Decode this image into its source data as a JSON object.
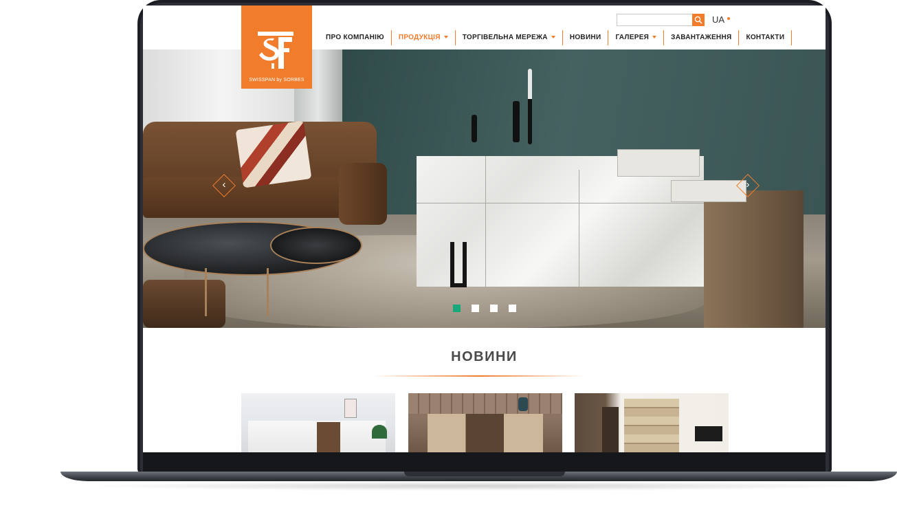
{
  "brand": {
    "logo_text": "SWISSPAN by SORBES",
    "accent_color": "#f07c2c",
    "active_dot_color": "#19a87a"
  },
  "header": {
    "search": {
      "placeholder": "",
      "icon": "search-icon"
    },
    "language": "UA"
  },
  "nav": {
    "items": [
      {
        "label": "ПРО КОМПАНІЮ",
        "active": false,
        "dropdown": false
      },
      {
        "label": "ПРОДУКЦІЯ",
        "active": true,
        "dropdown": true
      },
      {
        "label": "ТОРГІВЕЛЬНА МЕРЕЖА",
        "active": false,
        "dropdown": true
      },
      {
        "label": "НОВИНИ",
        "active": false,
        "dropdown": false
      },
      {
        "label": "ГАЛЕРЕЯ",
        "active": false,
        "dropdown": true
      },
      {
        "label": "ЗАВАНТАЖЕННЯ",
        "active": false,
        "dropdown": false
      },
      {
        "label": "КОНТАКТИ",
        "active": false,
        "dropdown": false
      }
    ]
  },
  "hero": {
    "prev_arrow": "‹",
    "next_arrow": "›",
    "slide_count": 4,
    "active_slide": 1
  },
  "news": {
    "title": "НОВИНИ",
    "cards": [
      {
        "image": "living-room-white-sideboard"
      },
      {
        "image": "brick-wall-cabinet"
      },
      {
        "image": "wood-panel-wall-tv"
      }
    ]
  }
}
